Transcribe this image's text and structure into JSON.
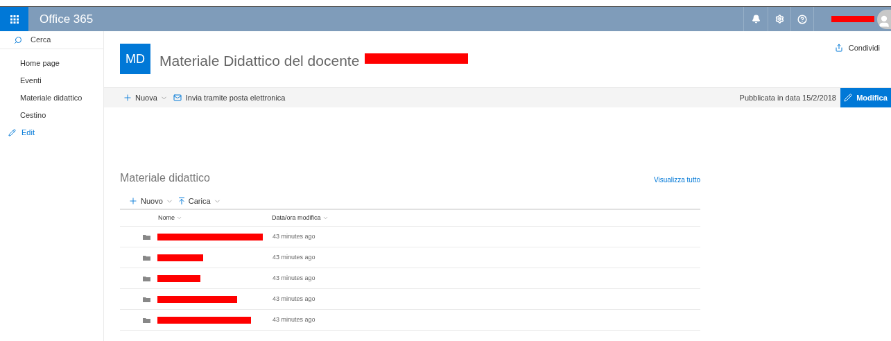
{
  "header": {
    "app_title": "Office 365"
  },
  "sidebar": {
    "search_label": "Cerca",
    "items": [
      {
        "label": "Home page"
      },
      {
        "label": "Eventi"
      },
      {
        "label": "Materiale didattico"
      },
      {
        "label": "Cestino"
      }
    ],
    "edit_link": "Edit"
  },
  "site": {
    "logo": "MD",
    "title": "Materiale Didattico del docente",
    "share": "Condividi"
  },
  "command_bar": {
    "new": "Nuova",
    "email": "Invia tramite posta elettronica",
    "published": "Pubblicata in data 15/2/2018",
    "edit": "Modifica"
  },
  "library": {
    "title": "Materiale didattico",
    "view_all": "Visualizza tutto",
    "new": "Nuovo",
    "upload": "Carica",
    "columns": [
      "Nome",
      "Data/ora modifica"
    ],
    "rows": [
      {
        "modified": "43 minutes ago"
      },
      {
        "modified": "43 minutes ago"
      },
      {
        "modified": "43 minutes ago"
      },
      {
        "modified": "43 minutes ago"
      },
      {
        "modified": "43 minutes ago"
      }
    ]
  }
}
